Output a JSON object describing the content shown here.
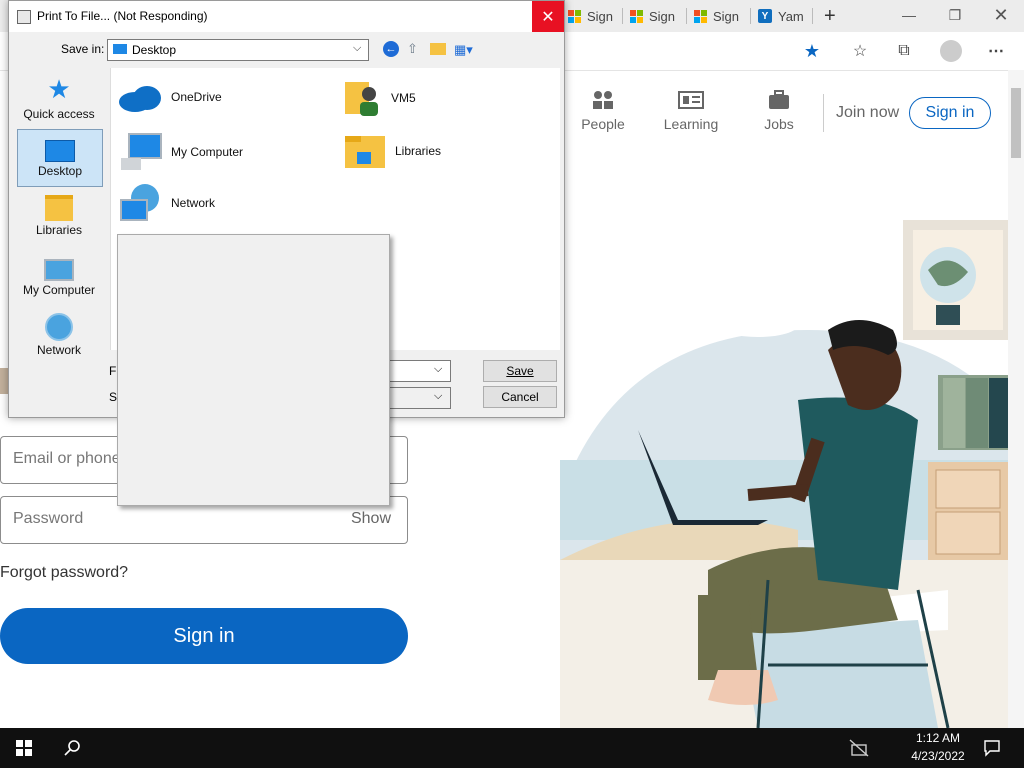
{
  "browser": {
    "tabs": [
      {
        "label": "Sign",
        "icon": "microsoft-logo"
      },
      {
        "label": "Sign",
        "icon": "microsoft-logo"
      },
      {
        "label": "Sign",
        "icon": "microsoft-logo"
      },
      {
        "label": "Yam",
        "icon": "yammer-logo"
      }
    ],
    "new_tab": "+"
  },
  "page": {
    "nav": [
      {
        "label": "People",
        "icon": "people-icon"
      },
      {
        "label": "Learning",
        "icon": "learning-icon"
      },
      {
        "label": "Jobs",
        "icon": "jobs-icon"
      }
    ],
    "join_now": "Join now",
    "sign_in_top": "Sign in",
    "email_placeholder": "Email or phone",
    "password_placeholder": "Password",
    "show": "Show",
    "forgot": "Forgot password?",
    "sign_in_button": "Sign in",
    "colors": {
      "brand": "#0a66c2"
    }
  },
  "dialog": {
    "title": "Print To File... (Not Responding)",
    "save_in_label": "Save in:",
    "save_in_value": "Desktop",
    "places": [
      {
        "label": "Quick access",
        "icon": "star-icon"
      },
      {
        "label": "Desktop",
        "icon": "desktop-icon",
        "selected": true
      },
      {
        "label": "Libraries",
        "icon": "libraries-icon"
      },
      {
        "label": "My Computer",
        "icon": "computer-icon"
      },
      {
        "label": "Network",
        "icon": "network-icon"
      }
    ],
    "files": [
      {
        "label": "OneDrive",
        "icon": "onedrive-icon"
      },
      {
        "label": "VM5",
        "icon": "user-folder-icon"
      },
      {
        "label": "My Computer",
        "icon": "computer-icon"
      },
      {
        "label": "Libraries",
        "icon": "libraries-icon"
      },
      {
        "label": "Network",
        "icon": "network-icon"
      }
    ],
    "file_name_label_partial": "Fi",
    "save_type_label_partial": "Sa",
    "save_button": "Save",
    "cancel_button": "Cancel"
  },
  "taskbar": {
    "time": "1:12 AM",
    "date": "4/23/2022"
  }
}
